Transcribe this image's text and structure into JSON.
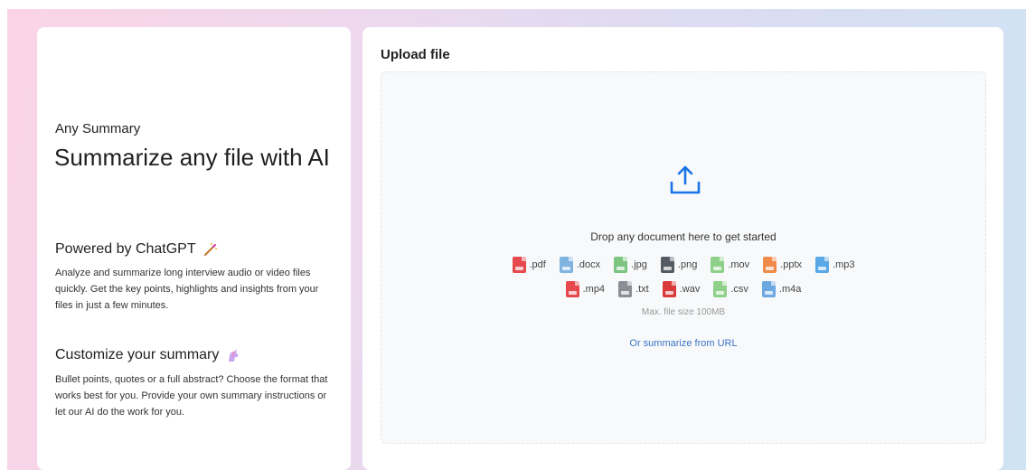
{
  "left": {
    "brand": "Any Summary",
    "headline": "Summarize any file with AI",
    "sections": [
      {
        "title": "Powered by ChatGPT",
        "icon": "magic-wand-icon",
        "description": "Analyze and summarize long interview audio or video files quickly. Get the key points, highlights and insights from your files in just a few minutes."
      },
      {
        "title": "Customize your summary",
        "icon": "unicorn-icon",
        "description": "Bullet points, quotes or a full abstract? Choose the format that works best for you. Provide your own summary instructions or let our AI do the work for you."
      }
    ]
  },
  "upload": {
    "title": "Upload file",
    "drop_text": "Drop any document here to get started",
    "max_size": "Max. file size 100MB",
    "url_link": "Or summarize from URL",
    "accent": "#1a73e8",
    "file_types_row1": [
      {
        "ext": ".pdf",
        "color": "#e5484d"
      },
      {
        "ext": ".docx",
        "color": "#7fb3e0"
      },
      {
        "ext": ".jpg",
        "color": "#7cc47f"
      },
      {
        "ext": ".png",
        "color": "#555b63"
      },
      {
        "ext": ".mov",
        "color": "#8fd18b"
      },
      {
        "ext": ".pptx",
        "color": "#f08a4b"
      },
      {
        "ext": ".mp3",
        "color": "#5aa9e6"
      }
    ],
    "file_types_row2": [
      {
        "ext": ".mp4",
        "color": "#e5484d"
      },
      {
        "ext": ".txt",
        "color": "#8a8f96"
      },
      {
        "ext": ".wav",
        "color": "#d93a3a"
      },
      {
        "ext": ".csv",
        "color": "#8fd18b"
      },
      {
        "ext": ".m4a",
        "color": "#6ea8e0"
      }
    ]
  }
}
